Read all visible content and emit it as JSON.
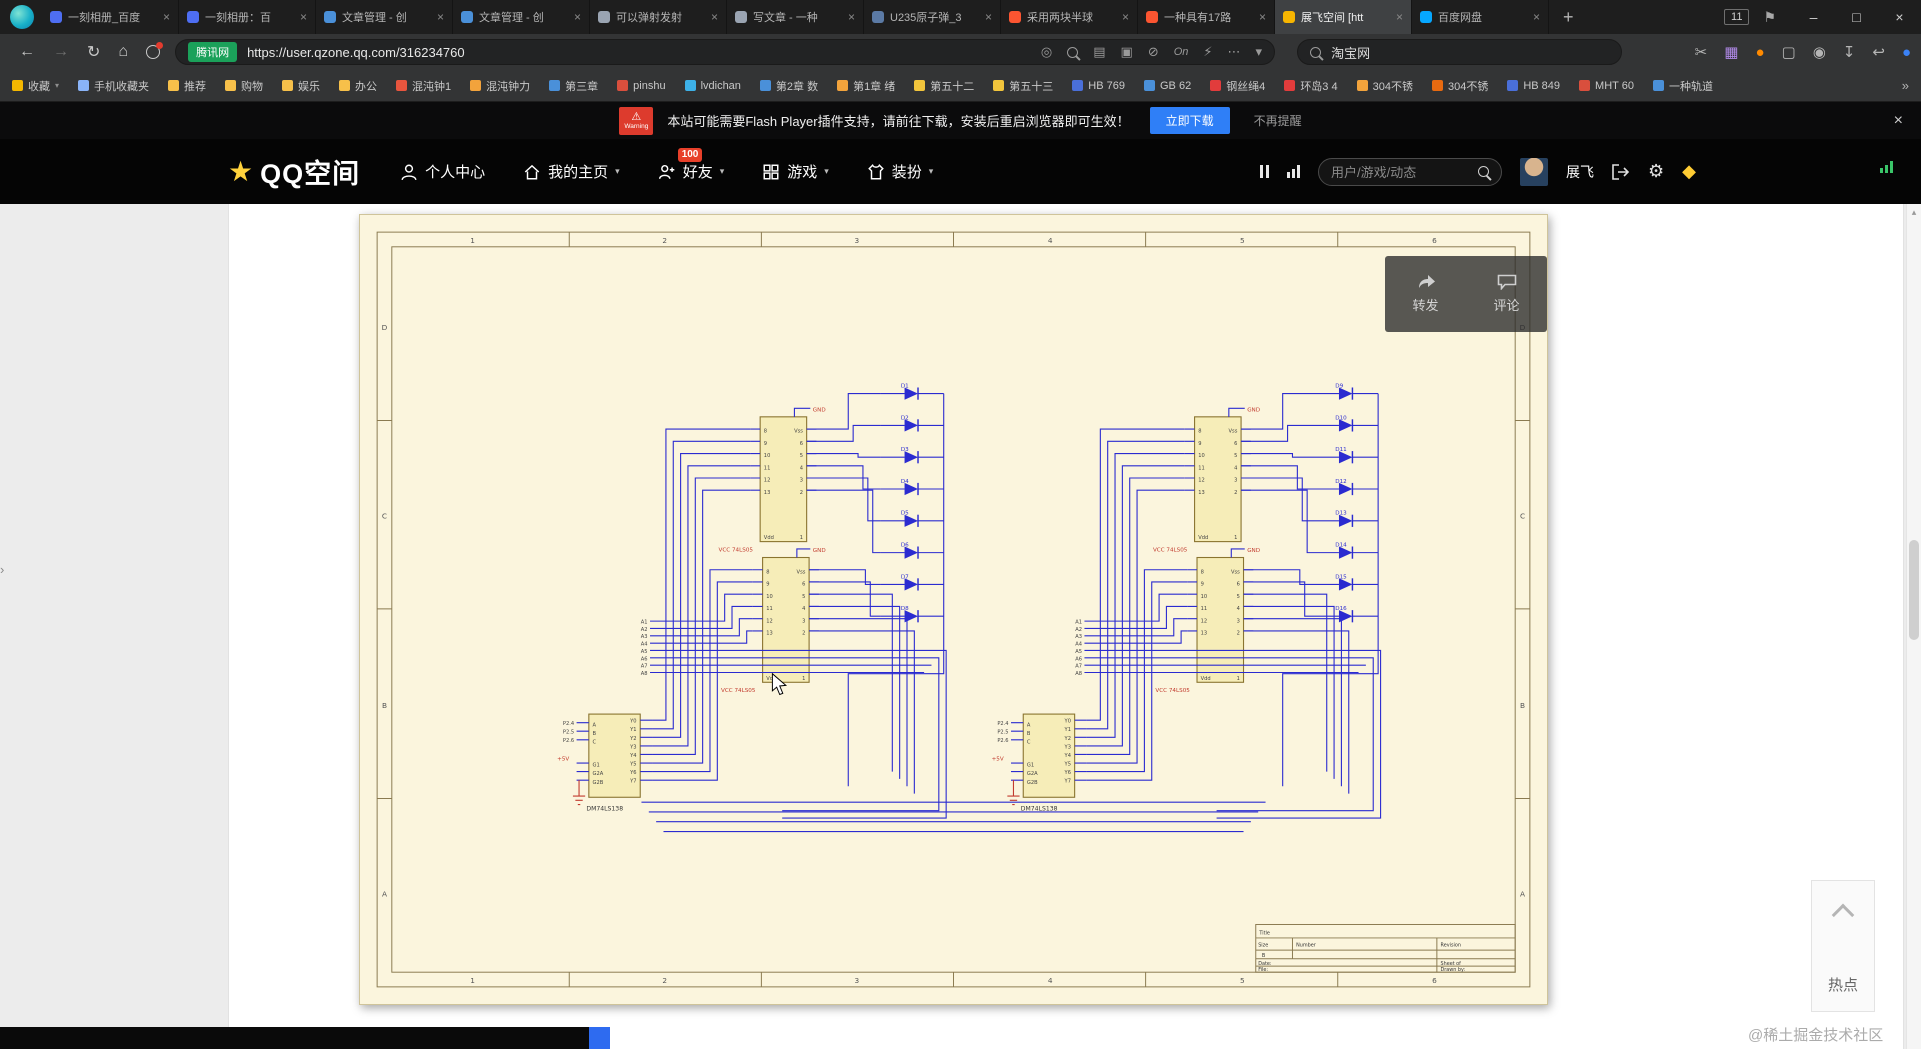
{
  "glyphs": {
    "back": "←",
    "forward": "→",
    "refresh": "↻",
    "home": "⌂",
    "target": "◎",
    "image": "▤",
    "camera": "▣",
    "adblock": "⊘",
    "bolt": "⚡",
    "dots": "⋯",
    "caret": "▾",
    "on": "On",
    "scissors": "✂",
    "grid": "▦",
    "dot": "●",
    "tv": "▢",
    "bug": "◉",
    "download": "↧",
    "undo": "↩",
    "sync": "↻",
    "flag": "⚑",
    "plus": "+",
    "min": "–",
    "max": "□",
    "close": "×",
    "overflow": "»",
    "up": "▴",
    "chevright": "›",
    "gear": "⚙",
    "diamond": "◆",
    "star": "★",
    "warning": "⚠"
  },
  "colors": {
    "qzone_yellow": "#ffd23c",
    "banner_button_blue": "#2f7ff7",
    "badge_red": "#e8402a",
    "site_badge_green": "#1ba15a",
    "wire_blue": "#2b2bd0"
  },
  "chrome": {
    "tab_count_badge": "11",
    "tabs": [
      {
        "title": "一刻相册_百度",
        "color": "#4e6ef2",
        "cls": ""
      },
      {
        "title": "一刻相册：百",
        "color": "#4e6ef2",
        "cls": ""
      },
      {
        "title": "文章管理 - 创",
        "color": "#4a90d9",
        "cls": ""
      },
      {
        "title": "文章管理 - 创",
        "color": "#4a90d9",
        "cls": ""
      },
      {
        "title": "可以弹射发射",
        "color": "#9aa4b2",
        "cls": ""
      },
      {
        "title": "写文章 - 一种",
        "color": "#9aa4b2",
        "cls": ""
      },
      {
        "title": "U235原子弹_3",
        "color": "#5b7aa5",
        "cls": ""
      },
      {
        "title": "采用两块半球",
        "color": "#fc5531",
        "cls": ""
      },
      {
        "title": "一种具有17路",
        "color": "#fc5531",
        "cls": ""
      },
      {
        "title": "展飞空间 [htt",
        "color": "#f7b500",
        "cls": "active"
      },
      {
        "title": "百度网盘",
        "color": "#06a7ff",
        "cls": ""
      }
    ]
  },
  "address_bar": {
    "site_badge": "腾讯网",
    "url": "https://user.qzone.qq.com/316234760",
    "search_value": "淘宝网"
  },
  "bookmarks": {
    "items": [
      {
        "label": "收藏",
        "color": "#f5b800",
        "caret": "▾"
      },
      {
        "label": "手机收藏夹",
        "color": "#8ab4f8",
        "caret": ""
      },
      {
        "label": "推荐",
        "color": "#f7c04a",
        "caret": ""
      },
      {
        "label": "购物",
        "color": "#f7c04a",
        "caret": ""
      },
      {
        "label": "娱乐",
        "color": "#f7c04a",
        "caret": ""
      },
      {
        "label": "办公",
        "color": "#f7c04a",
        "caret": ""
      },
      {
        "label": "混沌钟1",
        "color": "#e8553e",
        "caret": ""
      },
      {
        "label": "混沌钟力",
        "color": "#f2a33c",
        "caret": ""
      },
      {
        "label": "第三章",
        "color": "#4a90d9",
        "caret": ""
      },
      {
        "label": "pinshu",
        "color": "#d94f3d",
        "caret": ""
      },
      {
        "label": "lvdichan",
        "color": "#3db1e8",
        "caret": ""
      },
      {
        "label": "第2章 数",
        "color": "#4a90d9",
        "caret": ""
      },
      {
        "label": "第1章 绪",
        "color": "#f2a33c",
        "caret": ""
      },
      {
        "label": "第五十二",
        "color": "#f2c53c",
        "caret": ""
      },
      {
        "label": "第五十三",
        "color": "#f2c53c",
        "caret": ""
      },
      {
        "label": "HB 769",
        "color": "#4a6fd9",
        "caret": ""
      },
      {
        "label": "GB 62",
        "color": "#4a90d9",
        "caret": ""
      },
      {
        "label": "钢丝绳4",
        "color": "#e23c3c",
        "caret": ""
      },
      {
        "label": "环岛3 4",
        "color": "#e23c3c",
        "caret": ""
      },
      {
        "label": "304不锈",
        "color": "#f2a33c",
        "caret": ""
      },
      {
        "label": "304不锈",
        "color": "#e86a10",
        "caret": ""
      },
      {
        "label": "HB 849",
        "color": "#4a6fd9",
        "caret": ""
      },
      {
        "label": "MHT 60",
        "color": "#d94f3d",
        "caret": ""
      },
      {
        "label": "一种轨道",
        "color": "#4a90d9",
        "caret": ""
      }
    ]
  },
  "flash_banner": {
    "warning_caption": "Warning",
    "message": "本站可能需要Flash Player插件支持，请前往下载，安装后重启浏览器即可生效！",
    "download_button": "立即下载",
    "dismiss_link": "不再提醒"
  },
  "qzone": {
    "logo_text": "QQ空间",
    "nav_items": [
      {
        "label": "个人中心",
        "icon": "#icon-person",
        "caret": "",
        "badge": ""
      },
      {
        "label": "我的主页",
        "icon": "#icon-home",
        "caret": "▾",
        "badge": ""
      },
      {
        "label": "好友",
        "icon": "#icon-friends",
        "caret": "▾",
        "badge": "100"
      },
      {
        "label": "游戏",
        "icon": "#icon-games",
        "caret": "▾",
        "badge": ""
      },
      {
        "label": "装扮",
        "icon": "#icon-dress",
        "caret": "▾",
        "badge": ""
      }
    ],
    "search_placeholder": "用户/游戏/动态",
    "username": "展飞"
  },
  "post_actions": {
    "share": "转发",
    "comment": "评论"
  },
  "side": {
    "hot_label": "热点"
  },
  "watermark": "@稀土掘金技术社区",
  "schematic": {
    "ruler_columns": [
      "1",
      "2",
      "3",
      "4",
      "5",
      "6"
    ],
    "ruler_rows": [
      "D",
      "C",
      "B",
      "A"
    ],
    "ic": {
      "vss": "Vss",
      "vdd": "Vdd",
      "pins_left": [
        "8",
        "9",
        "10",
        "11",
        "12",
        "13"
      ],
      "pins_right": [
        "6",
        "5",
        "4",
        "3",
        "2",
        "1"
      ]
    },
    "ic_type_label": "VCC 74LS05",
    "gnd": "GND",
    "plus5v": "+5V",
    "decoder": {
      "name": "DM74LS138",
      "pins_left": [
        "A",
        "B",
        "C",
        "G1",
        "G2A",
        "G2B"
      ],
      "inputs": [
        "P2.4",
        "P2.5",
        "P2.6"
      ],
      "pins_right": [
        "Y0",
        "Y1",
        "Y2",
        "Y3",
        "Y4",
        "Y5",
        "Y6",
        "Y7"
      ]
    },
    "address_bus": [
      "A1",
      "A2",
      "A3",
      "A4",
      "A5",
      "A6",
      "A7",
      "A8"
    ],
    "leds_left": [
      "D1",
      "D2",
      "D3",
      "D4",
      "D5",
      "D6",
      "D7",
      "D8"
    ],
    "leds_right": [
      "D9",
      "D10",
      "D11",
      "D12",
      "D13",
      "D14",
      "D15",
      "D16"
    ],
    "title_block": {
      "title": "Title",
      "size": "Size",
      "size_value": "B",
      "number": "Number",
      "revision": "Revision",
      "date": "Date:",
      "sheet": "Sheet of",
      "file": "File:",
      "drawn": "Drawn by:"
    }
  }
}
